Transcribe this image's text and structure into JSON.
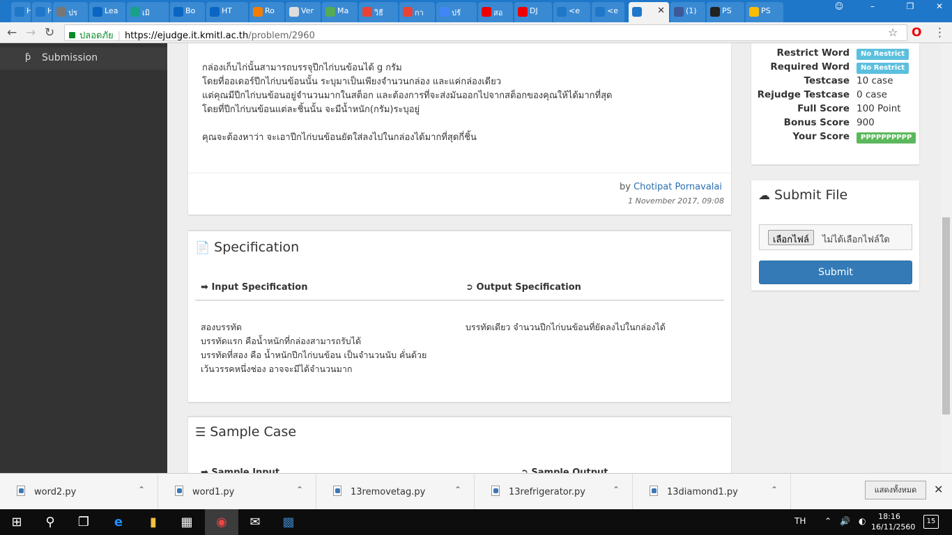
{
  "browser": {
    "tabs": [
      {
        "label": "Ha",
        "color": "#1f77c9"
      },
      {
        "label": "Ha",
        "color": "#1f77c9"
      },
      {
        "label": "ปร",
        "color": "#777"
      },
      {
        "label": "Lea",
        "color": "#0a66c2"
      },
      {
        "label": "เมิ",
        "color": "#18a08a"
      },
      {
        "label": "Bo",
        "color": "#0a66c2"
      },
      {
        "label": "HT",
        "color": "#0a66c2"
      },
      {
        "label": "Ro",
        "color": "#f57c00"
      },
      {
        "label": "Ver",
        "color": "#ddd"
      },
      {
        "label": "Ma",
        "color": "#5a5"
      },
      {
        "label": "วิธี",
        "color": "#ea4335"
      },
      {
        "label": "กา",
        "color": "#ea4335"
      },
      {
        "label": "ปรั",
        "color": "#4285f4"
      },
      {
        "label": "สอ",
        "color": "#e00"
      },
      {
        "label": "DJ",
        "color": "#e00"
      },
      {
        "label": "<e",
        "color": "#1f77c9"
      },
      {
        "label": "<e",
        "color": "#1f77c9"
      },
      {
        "label": "",
        "color": "#1f77c9"
      },
      {
        "label": "(1)",
        "color": "#3b5998"
      },
      {
        "label": "PS",
        "color": "#222"
      },
      {
        "label": "PS",
        "color": "#fbbc04"
      }
    ],
    "url_secure": "ปลอดภัย",
    "url_host": "https://ejudge.it.kmitl.ac.th",
    "url_path": "/problem/2960"
  },
  "sidebar": {
    "item_label": "Submission"
  },
  "problem": {
    "lines": [
      "กล่องเก็บไก่นั้นสามารถบรรจุปีกไก่บนข้อนได้ g กรัม",
      "โดยที่ออเดอร์ปีกไก่บนข้อนนั้น ระบุมาเป็นเพียงจำนวนกล่อง และแค่กล่องเดียว",
      "แต่คุณมีปีกไก่บนข้อนอยู่จำนวนมากในสต็อก และต้องการที่จะส่งมันออกไปจากสต็อกของคุณให้ได้มากที่สุด",
      "โดยที่ปีกไก่บนข้อนแต่ละชิ้นนั้น จะมีน้ำหนัก(กรัม)ระบุอยู่",
      "คุณจะต้องหาว่า จะเอาปีกไก่บนข้อนยัดใส่ลงไปในกล่องได้มากที่สุดกี่ชิ้น"
    ],
    "author_prefix": "by",
    "author": "Chotipat Pornavalai",
    "date": "1 November 2017, 09:08"
  },
  "spec": {
    "title": "Specification",
    "input_title": "Input Specification",
    "output_title": "Output Specification",
    "input_lines": [
      "สองบรรทัด",
      "บรรทัดแรก คือน้ำหนักที่กล่องสามารถรับได้",
      "บรรทัดที่สอง คือ น้ำหนักปีกไก่บนข้อน เป็นจำนวนนับ  คั่นด้วย",
      "เว้นวรรคหนึ่งช่อง อาจจะมีได้จำนวนมาก"
    ],
    "output_text": "บรรทัดเดียว จำนวนปีกไก่บนข้อนที่ยัดลงไปในกล่องได้"
  },
  "sample": {
    "title": "Sample Case",
    "input_title": "Sample Input",
    "output_title": "Sample Output"
  },
  "info": {
    "rows": [
      {
        "label": "Restrict Word",
        "badge": "No Restrict",
        "badge_color": "#5bc0de"
      },
      {
        "label": "Required Word",
        "badge": "No Restrict",
        "badge_color": "#5bc0de"
      },
      {
        "label": "Testcase",
        "value": "10 case"
      },
      {
        "label": "Rejudge Testcase",
        "value": "0 case"
      },
      {
        "label": "Full Score",
        "value": "100 Point"
      },
      {
        "label": "Bonus Score",
        "value": "900"
      },
      {
        "label": "Your Score",
        "badge": "PPPPPPPPPP",
        "badge_color": "#5cb85c"
      }
    ]
  },
  "submit": {
    "title": "Submit File",
    "choose_label": "เลือกไฟล์",
    "no_file": "ไม่ได้เลือกไฟล์ใด",
    "button": "Submit"
  },
  "downloads": {
    "files": [
      "word2.py",
      "word1.py",
      "13removetag.py",
      "13refrigerator.py",
      "13diamond1.py"
    ],
    "show_all": "แสดงทั้งหมด"
  },
  "taskbar": {
    "lang": "TH",
    "time": "18:16",
    "date": "16/11/2560",
    "notifications": "15"
  }
}
